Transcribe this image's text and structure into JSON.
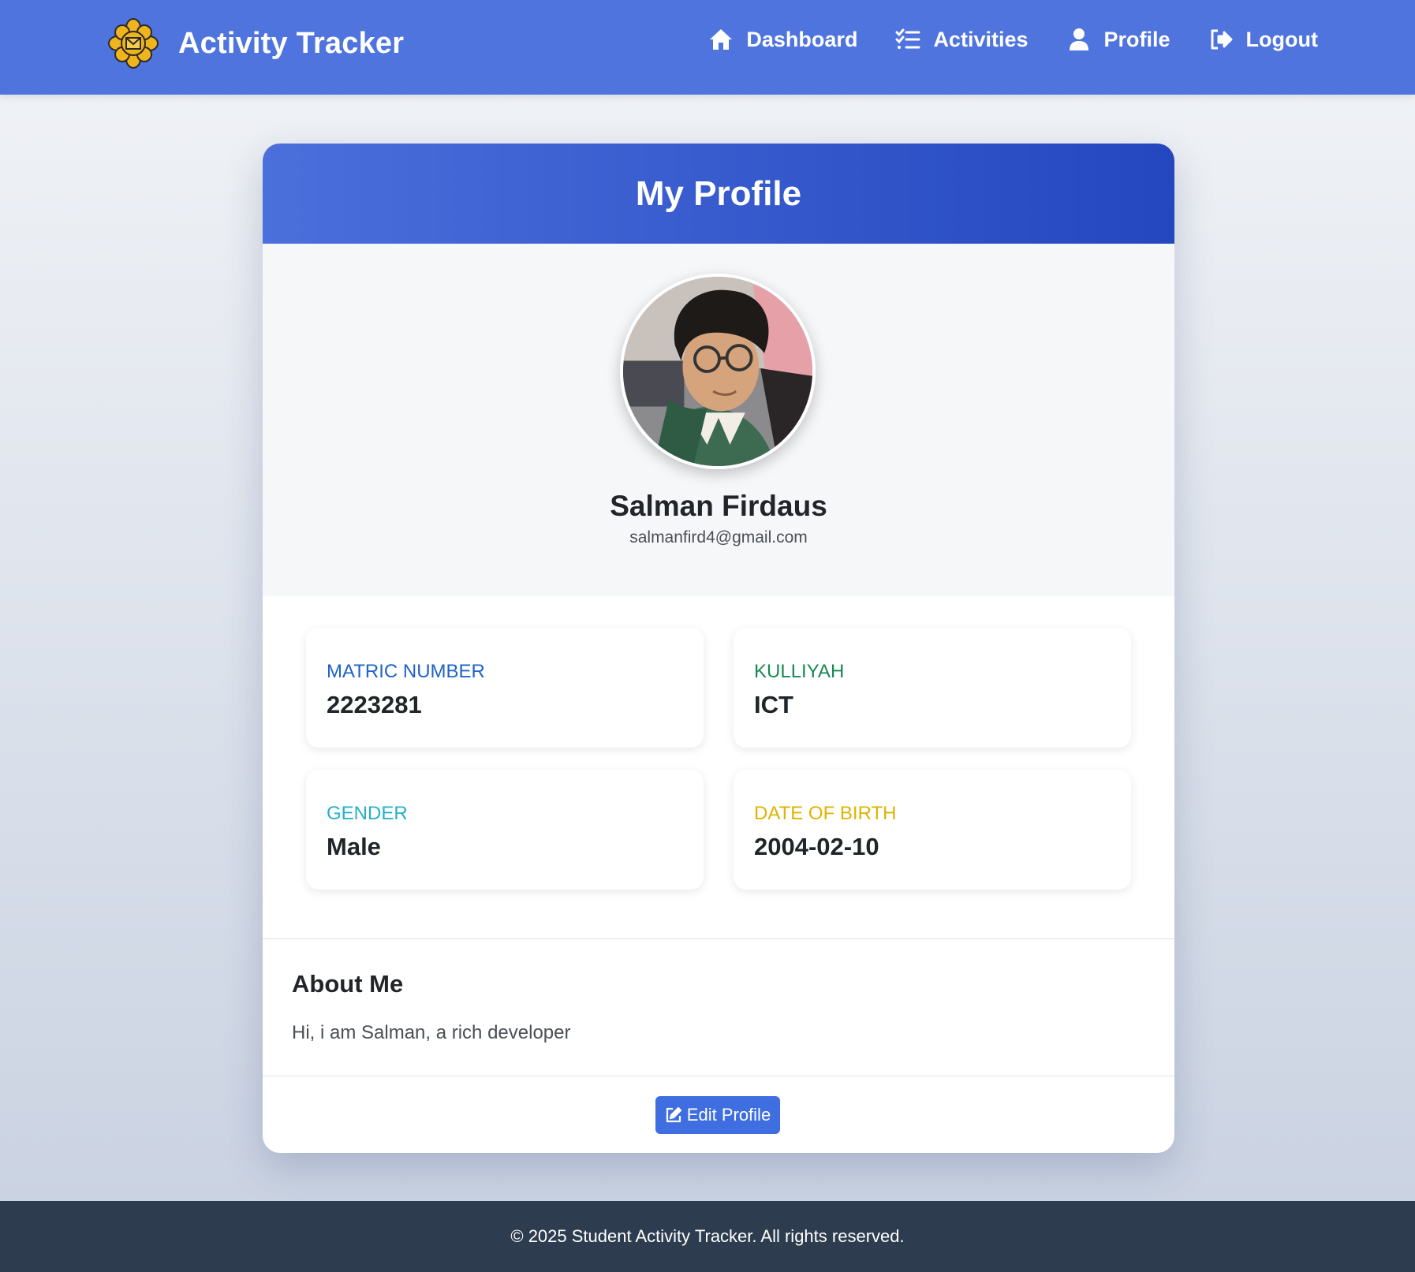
{
  "navbar": {
    "brand": "Activity Tracker",
    "logo_icon": "university-emblem-icon",
    "items": [
      {
        "label": "Dashboard",
        "icon": "home-icon"
      },
      {
        "label": "Activities",
        "icon": "checklist-icon"
      },
      {
        "label": "Profile",
        "icon": "user-icon"
      },
      {
        "label": "Logout",
        "icon": "logout-icon"
      }
    ]
  },
  "profile": {
    "title": "My Profile",
    "name": "Salman Firdaus",
    "email": "salmanfird4@gmail.com",
    "fields": [
      {
        "label": "MATRIC NUMBER",
        "value": "2223281",
        "color": "#1f63c6"
      },
      {
        "label": "KULLIYAH",
        "value": "ICT",
        "color": "#198754"
      },
      {
        "label": "GENDER",
        "value": "Male",
        "color": "#27b0c9"
      },
      {
        "label": "DATE OF BIRTH",
        "value": "2004-02-10",
        "color": "#e0b300"
      }
    ],
    "about_title": "About Me",
    "about_text": "Hi, i am Salman, a rich developer",
    "edit_label": "Edit Profile"
  },
  "footer": {
    "text": "© 2025 Student Activity Tracker. All rights reserved."
  },
  "colors": {
    "navbar": "#4f74de",
    "header_start": "#4b6fdb",
    "header_end": "#2447c0",
    "button": "#3f6ee0",
    "footer": "#2e3c50"
  }
}
